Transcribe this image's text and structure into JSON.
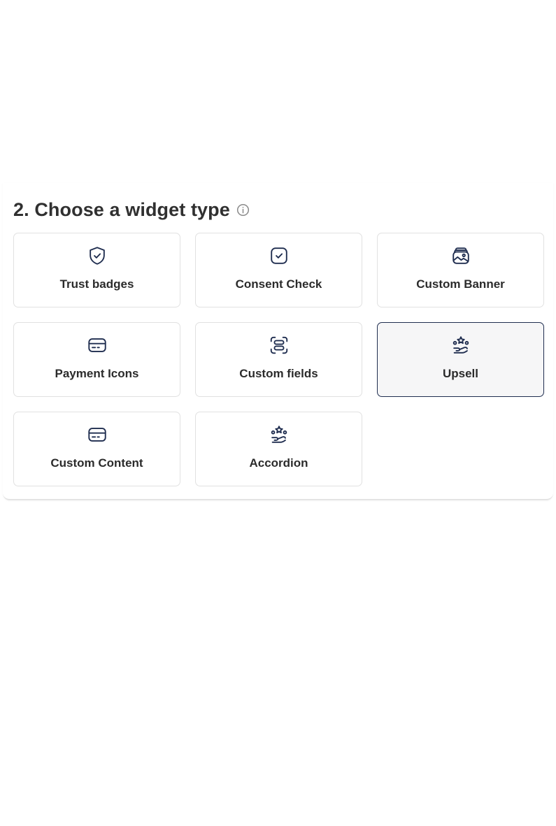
{
  "section": {
    "title": "2. Choose a widget type",
    "info_icon": "info-circle-icon"
  },
  "widgets": [
    {
      "label": "Trust badges",
      "icon": "shield-check-icon",
      "selected": false
    },
    {
      "label": "Consent Check",
      "icon": "checkbox-check-icon",
      "selected": false
    },
    {
      "label": "Custom Banner",
      "icon": "wallet-image-icon",
      "selected": false
    },
    {
      "label": "Payment Icons",
      "icon": "credit-card-icon",
      "selected": false
    },
    {
      "label": "Custom fields",
      "icon": "form-fields-icon",
      "selected": false
    },
    {
      "label": "Upsell",
      "icon": "stars-hand-icon",
      "selected": true
    },
    {
      "label": "Custom Content",
      "icon": "credit-card-icon",
      "selected": false
    },
    {
      "label": "Accordion",
      "icon": "stars-hand-icon",
      "selected": false
    }
  ],
  "colors": {
    "selected_border": "#1f2d4f",
    "selected_background": "#f6f6f7",
    "card_border": "#e1e1e1",
    "icon_stroke": "#1f2d4f"
  }
}
